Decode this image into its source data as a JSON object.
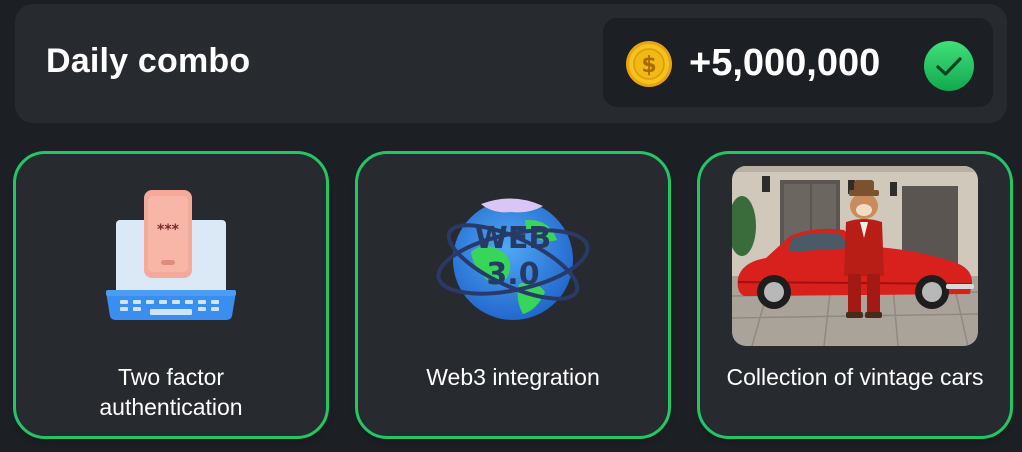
{
  "combo": {
    "title": "Daily combo",
    "reward": "+5,000,000",
    "coin_icon": "gold-coin-dollar-icon",
    "status_icon": "green-check-icon",
    "accent_color": "#21c764",
    "coin_color": "#f7c31b"
  },
  "cards": [
    {
      "label": "Two factor authentication",
      "icon": "laptop-phone-password-icon"
    },
    {
      "label": "Web3 integration",
      "icon": "web3-globe-icon",
      "icon_text_line1": "WEB",
      "icon_text_line2": "3.0"
    },
    {
      "label": "Collection of vintage cars",
      "icon": "hamster-vintage-red-car-photo"
    }
  ]
}
